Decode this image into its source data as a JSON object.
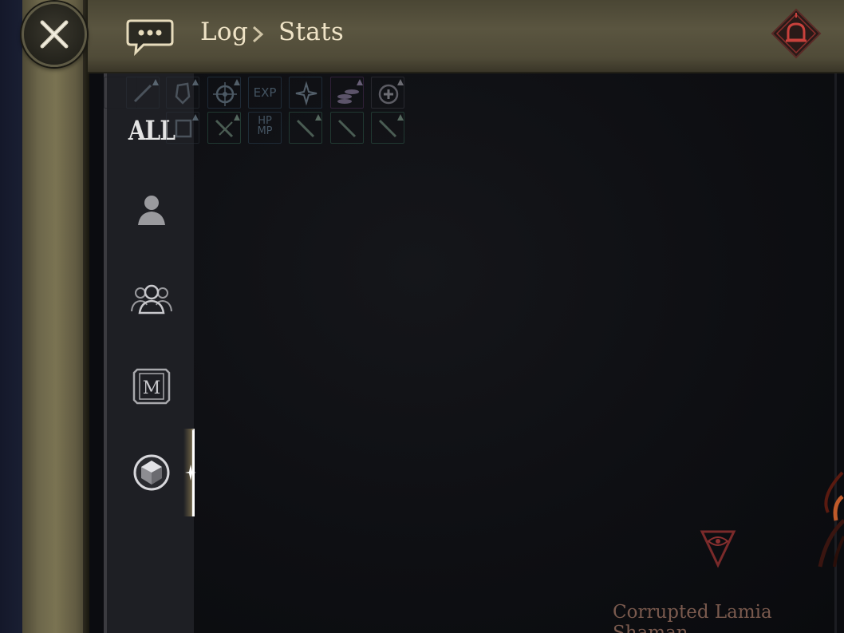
{
  "header": {
    "breadcrumb": {
      "root": "Log",
      "current": "Stats"
    }
  },
  "tabs": {
    "all_label": "ALL",
    "items": [
      {
        "key": "all",
        "icon": "all-text"
      },
      {
        "key": "self",
        "icon": "person-icon"
      },
      {
        "key": "party",
        "icon": "party-icon"
      },
      {
        "key": "guild",
        "icon": "guild-emblem-icon"
      },
      {
        "key": "other",
        "icon": "gem-icon",
        "active": true
      }
    ]
  },
  "buffs": {
    "row1": [
      "ghost-icon",
      "sword-up-icon",
      "shield-up-icon",
      "crosshair-up-icon",
      "EXP",
      "sparkle-icon",
      "coins-up-icon",
      "heal-cycle-icon"
    ],
    "row2": [
      "ghost-icon",
      "ALL",
      "armor-up-icon",
      "sword-cross-up-icon",
      "HP MP",
      "sword-up-icon",
      "sword-icon",
      "sword-up-icon"
    ],
    "exp_label": "EXP",
    "hpmp_label": "HP\nMP"
  },
  "target": {
    "name": "Corrupted Lamia Shaman"
  },
  "colors": {
    "parchment": "#6d674b",
    "content_bg": "#0e0f13",
    "tab_bg": "#1e1f24",
    "enemy_name": "#7a5a4e",
    "alert_red": "#b03b3b"
  }
}
